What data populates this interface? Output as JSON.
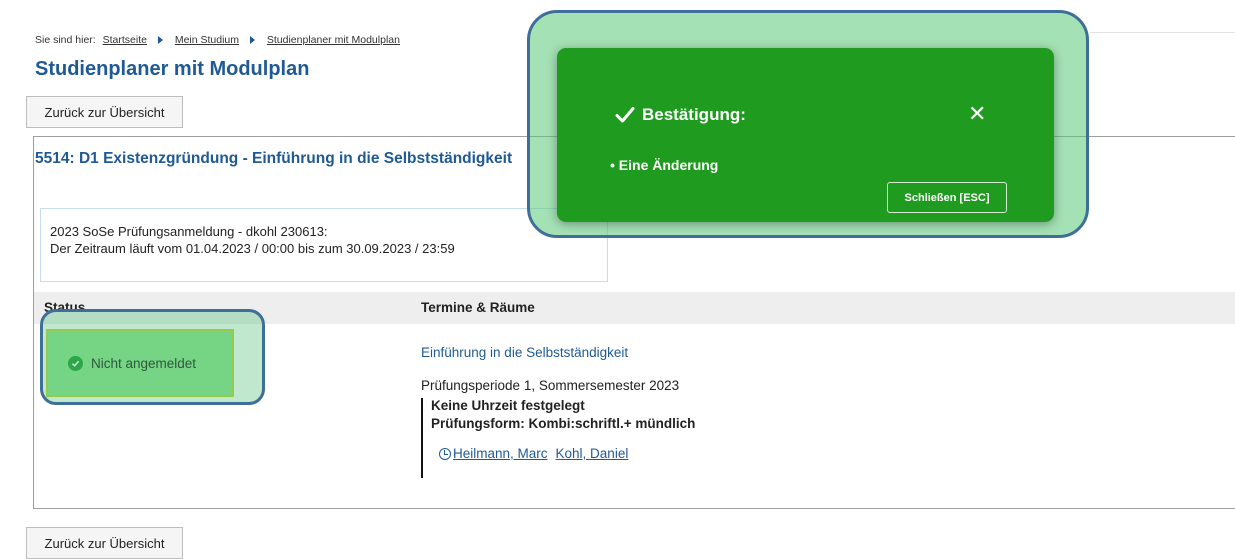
{
  "breadcrumb": {
    "prefix": "Sie sind hier:",
    "items": [
      "Startseite",
      "Mein Studium",
      "Studienplaner mit Modulplan"
    ]
  },
  "page": {
    "title": "Studienplaner mit Modulplan",
    "back_button": "Zurück zur Übersicht",
    "back_button_bottom": "Zurück zur Übersicht"
  },
  "module": {
    "title": "5514: D1 Existenzgründung - Einführung in die Selbstständigkeit",
    "period_line1": "2023 SoSe Prüfungsanmeldung - dkohl 230613:",
    "period_line2": "Der Zeitraum läuft vom 01.04.2023 / 00:00 bis zum 30.09.2023 / 23:59"
  },
  "table": {
    "col_status": "Status",
    "col_termine": "Termine & Räume",
    "status_value": "Nicht angemeldet",
    "event_link": "Einführung in die Selbstständigkeit",
    "exam_period": "Prüfungsperiode 1, Sommersemester 2023",
    "time": "Keine Uhrzeit festgelegt",
    "exam_form": "Prüfungsform: Kombi:schriftl.+ mündlich",
    "people": [
      "Heilmann, Marc",
      "Kohl, Daniel"
    ]
  },
  "toast": {
    "title": "Bestätigung:",
    "close_symbol": "✕",
    "message": "• Eine Änderung",
    "esc_button": "Schließen [ESC]"
  },
  "colors": {
    "accent": "#1f5a96",
    "toast_bg": "#1f9c1f",
    "status_ok": "#1e9b32",
    "highlight_border": "#3d6f98"
  }
}
